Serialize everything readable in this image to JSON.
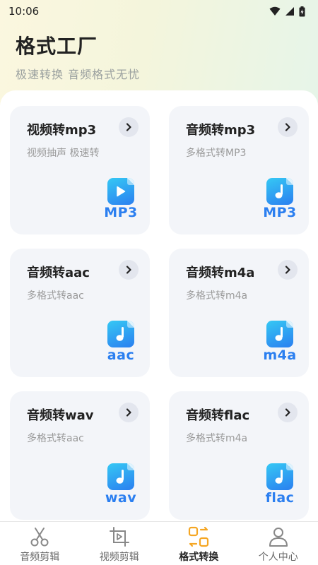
{
  "status_bar": {
    "time": "10:06"
  },
  "header": {
    "title": "格式工厂",
    "subtitle": "极速转换 音频格式无忧"
  },
  "cards": [
    {
      "title": "视频转mp3",
      "desc": "视频抽声 极速转",
      "ext": "MP3",
      "icon": "video-play-icon"
    },
    {
      "title": "音频转mp3",
      "desc": "多格式转MP3",
      "ext": "MP3",
      "icon": "music-note-icon"
    },
    {
      "title": "音频转aac",
      "desc": "多格式转aac",
      "ext": "aac",
      "icon": "music-note-icon"
    },
    {
      "title": "音频转m4a",
      "desc": "多格式转m4a",
      "ext": "m4a",
      "icon": "music-note-icon"
    },
    {
      "title": "音频转wav",
      "desc": "多格式转aac",
      "ext": "wav",
      "icon": "music-note-icon"
    },
    {
      "title": "音频转flac",
      "desc": "多格式转m4a",
      "ext": "flac",
      "icon": "music-note-icon"
    }
  ],
  "bottom_nav": [
    {
      "label": "音频剪辑",
      "icon": "scissors-icon",
      "active": false
    },
    {
      "label": "视频剪辑",
      "icon": "video-crop-icon",
      "active": false
    },
    {
      "label": "格式转换",
      "icon": "convert-icon",
      "active": true
    },
    {
      "label": "个人中心",
      "icon": "person-icon",
      "active": false
    }
  ],
  "colors": {
    "accent": "#2b7ff0",
    "active_nav": "#f5a623",
    "card_bg": "#f3f5f9"
  }
}
